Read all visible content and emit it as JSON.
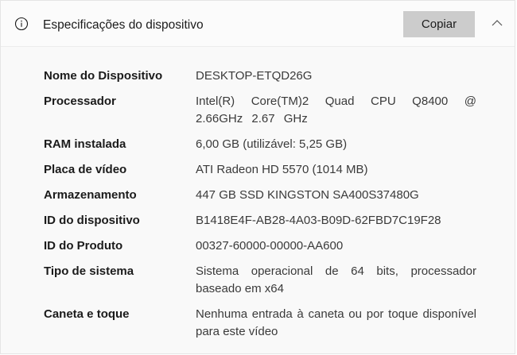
{
  "header": {
    "title": "Especificações do dispositivo",
    "copy_label": "Copiar",
    "info_icon": "info-icon",
    "chevron_icon": "chevron-up-icon"
  },
  "specs": [
    {
      "label": "Nome do Dispositivo",
      "value": "DESKTOP-ETQD26G"
    },
    {
      "label": "Processador",
      "value": "Intel(R) Core(TM)2 Quad CPU Q8400 @ 2.66GHz 2.67 GHz"
    },
    {
      "label": "RAM instalada",
      "value": "6,00 GB (utilizável: 5,25 GB)"
    },
    {
      "label": "Placa de vídeo",
      "value": "ATI Radeon HD 5570 (1014 MB)"
    },
    {
      "label": "Armazenamento",
      "value": "447 GB SSD KINGSTON SA400S37480G"
    },
    {
      "label": "ID do dispositivo",
      "value": "B1418E4F-AB28-4A03-B09D-62FBD7C19F28"
    },
    {
      "label": "ID do Produto",
      "value": "00327-60000-00000-AA600"
    },
    {
      "label": "Tipo de sistema",
      "value": "Sistema operacional de 64 bits, processador baseado em x64"
    },
    {
      "label": "Caneta e toque",
      "value": "Nenhuma entrada à caneta ou por toque disponível para este vídeo"
    }
  ]
}
